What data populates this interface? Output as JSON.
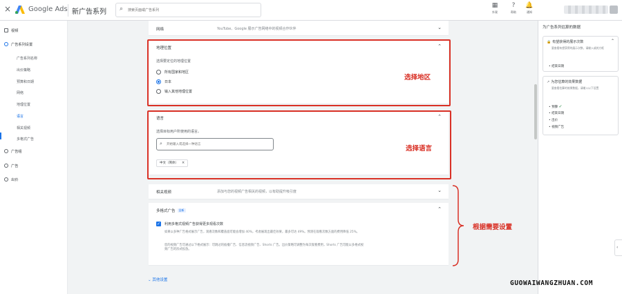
{
  "topbar": {
    "close": "×",
    "brand": "Google Ads",
    "page_title": "新广告系列",
    "search_placeholder": "搜索页面或广告系列",
    "actions": [
      {
        "icon": "chart-report-icon",
        "glyph": "▦",
        "label": "外观"
      },
      {
        "icon": "help-icon",
        "glyph": "?",
        "label": "帮助"
      },
      {
        "icon": "bell-icon",
        "glyph": "🔔",
        "label": "通知"
      }
    ]
  },
  "leftnav": {
    "items": [
      {
        "label": "视频",
        "type": "top"
      },
      {
        "label": "广告系列设置",
        "type": "top-active"
      },
      {
        "label": "广告系列名称",
        "type": "sub"
      },
      {
        "label": "出价策略",
        "type": "sub"
      },
      {
        "label": "预算和日期",
        "type": "sub"
      },
      {
        "label": "网络",
        "type": "sub"
      },
      {
        "label": "地理位置",
        "type": "sub"
      },
      {
        "label": "语言",
        "type": "sub-active"
      },
      {
        "label": "相关视频",
        "type": "sub"
      },
      {
        "label": "多格式广告",
        "type": "sub"
      },
      {
        "label": "广告组",
        "type": "top"
      },
      {
        "label": "广告",
        "type": "top"
      },
      {
        "label": "出价",
        "type": "top"
      }
    ]
  },
  "network": {
    "title": "网络",
    "desc": "YouTube、Google 展示广告网络中的视频合作伙伴"
  },
  "location": {
    "title": "地理位置",
    "prompt": "选择要定位的地理位置",
    "options": [
      "所有国家和地区",
      "日本",
      "输入其他地理位置"
    ],
    "selected_index": 1
  },
  "language": {
    "title": "语言",
    "prompt": "选择目标用户所使用的语言。",
    "search_placeholder": "开始输入或选择一种语言",
    "chip": "中文（简体）",
    "chip_remove": "×"
  },
  "related_videos": {
    "title": "相关视频",
    "desc": "添加与您的视频广告相关的视频，以有助提升吸引度"
  },
  "multiformat": {
    "title": "多格式广告",
    "badge": "全新",
    "checkbox_label": "利用多格式视频广告获得更多观看次数",
    "checked": true,
    "para1": "如果以多种广告格式展示广告，观看次数和覆盖面可能会增加 40%，考虑展现出最佳效果，最多可达 49%。预测在观看次数方面的费用降低 25%。",
    "para2": "您的视频广告可通过以下格式展示：可跳过的插播广告、信息流视频广告、Shorts 广告。出价策略可调整为每次观看费用，Shorts 广告可能以多格式视频广告的形式投放。"
  },
  "other_settings": "⌄ 其他设置",
  "annotations": {
    "location": "选择地区",
    "language": "选择语言",
    "multiformat": "根据需要设置"
  },
  "rightpanel": {
    "title": "为广告系列估算的数据",
    "box1": {
      "title": "有望获得的展示次数",
      "desc": "要查看有望获得的展示次数，请输入或其方框",
      "bullets": [
        "结束日期"
      ]
    },
    "box2": {
      "title": "为您估算的效果数据",
      "desc": "要查看估算的效果数据，请输入以下设置",
      "bullets": [
        {
          "label": "预算",
          "done": true
        },
        {
          "label": "结束日期",
          "done": false
        },
        {
          "label": "出价",
          "done": false
        },
        {
          "label": "视频广告",
          "done": false
        }
      ]
    }
  },
  "watermark": "GUOWAIWANGZHUAN.COM",
  "colors": {
    "accent": "#1a73e8",
    "annotation": "#d93025",
    "check": "#188038"
  }
}
